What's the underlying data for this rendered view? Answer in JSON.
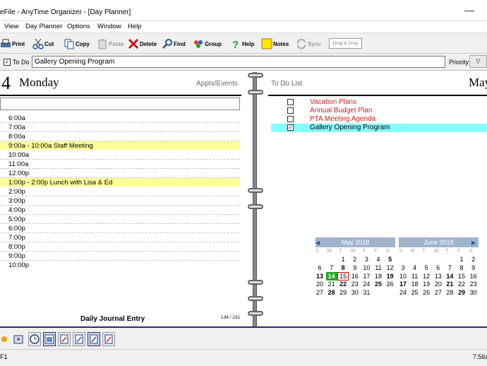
{
  "window": {
    "title": "eFile - AnyTime Organizer - [Day Planner]"
  },
  "menu": [
    "View",
    "Day Planner",
    "Options",
    "Window",
    "Help"
  ],
  "toolbar": {
    "print": "Print",
    "cut": "Cut",
    "copy": "Copy",
    "paste": "Paste",
    "delete": "Delete",
    "find": "Find",
    "group": "Group",
    "help": "Help",
    "notes": "Notes",
    "sync": "Sync",
    "dragdrop": "Drag & Drop"
  },
  "todobar": {
    "checkbox_label": "To Do",
    "input_value": "Gallery Opening Program",
    "priority_label": "Priority"
  },
  "left_page": {
    "day_number": "4",
    "day_name": "Monday",
    "section_label": "Appts/Events",
    "times": [
      "6:00a",
      "7:00a",
      "8:00a",
      "10:00a",
      "11:00a",
      "12:00p",
      "2:00p",
      "3:00p",
      "4:00p",
      "5:00p",
      "6:00p",
      "7:00p",
      "8:00p",
      "9:00p",
      "10:00p"
    ],
    "appointments": [
      {
        "text": "9:00a - 10:00a  Staff Meeting"
      },
      {
        "text": "1:00p - 2:00p  Lunch with Lisa & Ed"
      }
    ],
    "journal_label": "Daily Journal Entry",
    "page_count": "134 / 231"
  },
  "right_page": {
    "section_label": "To Do List",
    "month_label": "May",
    "todos": [
      {
        "text": "Vacation Plans",
        "checked": ""
      },
      {
        "text": "Annual Budget Plan",
        "checked": ""
      },
      {
        "text": "PTA Meeting Agenda",
        "checked": ""
      },
      {
        "text": "Gallery Opening Program",
        "checked": "✓"
      }
    ]
  },
  "calendars": [
    {
      "title": "May 2018",
      "dow": [
        "S",
        "M",
        "T",
        "W",
        "T",
        "F",
        "S"
      ],
      "weeks": [
        [
          "",
          "",
          "1",
          "2",
          "3",
          "4",
          "5"
        ],
        [
          "6",
          "7",
          "8",
          "9",
          "10",
          "11",
          "12"
        ],
        [
          "13",
          "14",
          "15",
          "16",
          "17",
          "18",
          "19"
        ],
        [
          "20",
          "21",
          "22",
          "23",
          "24",
          "25",
          "26"
        ],
        [
          "27",
          "28",
          "29",
          "30",
          "31",
          "",
          ""
        ]
      ]
    },
    {
      "title": "June 2018",
      "dow": [
        "S",
        "M",
        "T",
        "W",
        "T",
        "F",
        "S"
      ],
      "weeks": [
        [
          "",
          "",
          "",
          "",
          "",
          "1",
          "2"
        ],
        [
          "3",
          "4",
          "5",
          "6",
          "7",
          "8",
          "9"
        ],
        [
          "10",
          "11",
          "12",
          "13",
          "14",
          "15",
          "16"
        ],
        [
          "17",
          "18",
          "19",
          "20",
          "21",
          "22",
          "23"
        ],
        [
          "24",
          "25",
          "26",
          "27",
          "28",
          "29",
          "30"
        ]
      ]
    }
  ],
  "status": {
    "left": "F1",
    "right": "7:56a"
  },
  "colors": {
    "appt_highlight": "#ffff99",
    "todo_selected": "#88ffff",
    "today": "#22aa22",
    "todo_text": "#cc2222",
    "calendar_header": "#a0b4cc"
  }
}
